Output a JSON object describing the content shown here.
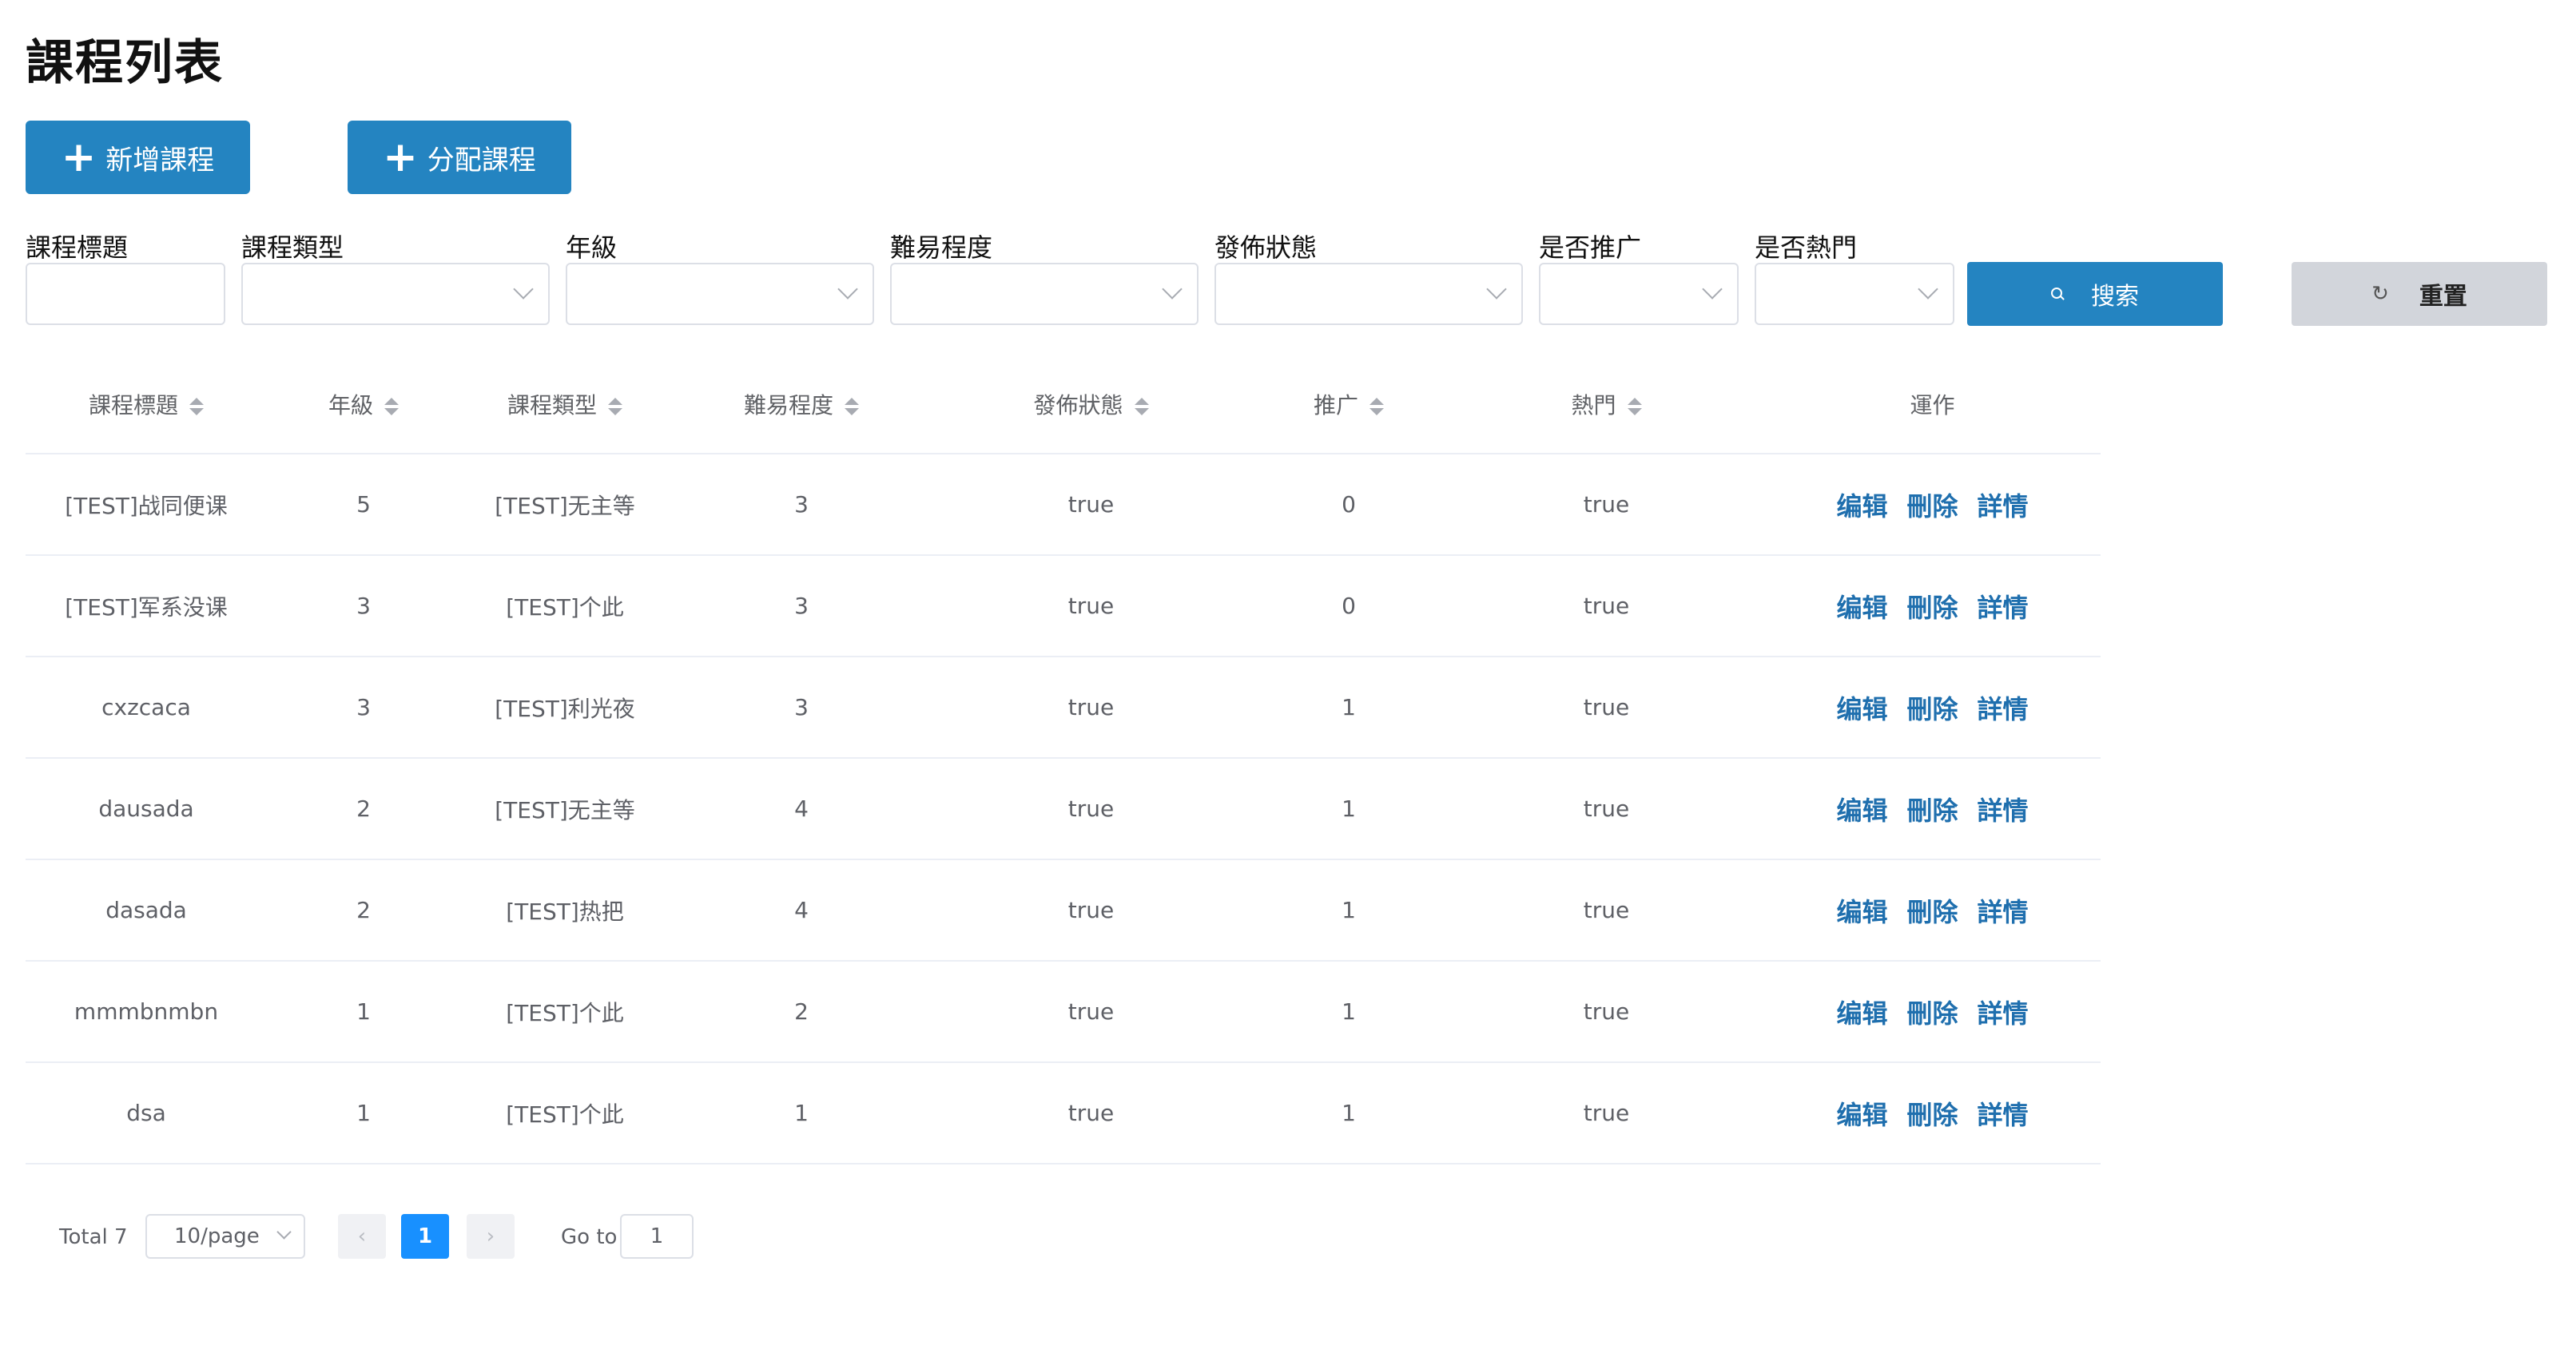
{
  "page": {
    "title": "課程列表"
  },
  "toolbar": {
    "add_label": "新增課程",
    "assign_label": "分配課程"
  },
  "filters": {
    "title_label": "課程標題",
    "type_label": "課程類型",
    "grade_label": "年級",
    "difficulty_label": "難易程度",
    "publish_label": "發佈狀態",
    "promote_label": "是否推广",
    "hot_label": "是否熱門",
    "search_label": "搜索",
    "reset_label": "重置"
  },
  "table": {
    "headers": [
      "課程標題",
      "年級",
      "課程類型",
      "難易程度",
      "發佈狀態",
      "推广",
      "熱門",
      "運作"
    ],
    "rows": [
      [
        "[TEST]战同便课",
        "5",
        "[TEST]无主等",
        "3",
        "true",
        "0",
        "true"
      ],
      [
        "[TEST]军系没课",
        "3",
        "[TEST]个此",
        "3",
        "true",
        "0",
        "true"
      ],
      [
        "cxzcaca",
        "3",
        "[TEST]利光夜",
        "3",
        "true",
        "1",
        "true"
      ],
      [
        "dausada",
        "2",
        "[TEST]无主等",
        "4",
        "true",
        "1",
        "true"
      ],
      [
        "dasada",
        "2",
        "[TEST]热把",
        "4",
        "true",
        "1",
        "true"
      ],
      [
        "mmmbnmbn",
        "1",
        "[TEST]个此",
        "2",
        "true",
        "1",
        "true"
      ],
      [
        "dsa",
        "1",
        "[TEST]个此",
        "1",
        "true",
        "1",
        "true"
      ]
    ],
    "actions": {
      "edit": "编辑",
      "delete": "刪除",
      "detail": "詳情"
    }
  },
  "pagination": {
    "total_label": "Total 7",
    "page_size": "10/page",
    "current_page": "1",
    "goto_label": "Go to",
    "goto_value": "1"
  },
  "colors": {
    "primary": "#2484c1",
    "link": "#1f6fae",
    "page_active": "#1890ff",
    "reset_bg": "#d2d5db"
  }
}
